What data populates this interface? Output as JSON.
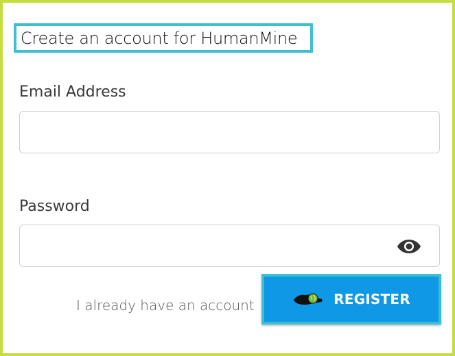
{
  "form": {
    "title": "Create an account for HumanMine",
    "email": {
      "label": "Email Address",
      "value": "",
      "placeholder": ""
    },
    "password": {
      "label": "Password",
      "value": "",
      "placeholder": "",
      "toggle_icon": "eye-icon"
    },
    "login_link": "I already have an account",
    "register": {
      "label": "REGISTER",
      "icon": "hand-globe-icon"
    }
  },
  "colors": {
    "frame_border": "#c5dd3f",
    "highlight_border": "#3cbfd0",
    "button_bg": "#0e98e6",
    "button_text": "#ffffff"
  }
}
